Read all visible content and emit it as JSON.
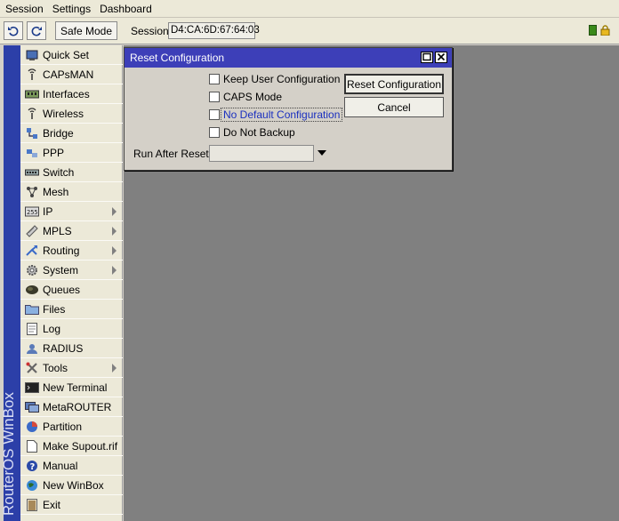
{
  "menubar": {
    "items": [
      "Session",
      "Settings",
      "Dashboard"
    ]
  },
  "toolbar": {
    "undo_icon": "undo-icon",
    "redo_icon": "redo-icon",
    "safe_mode_label": "Safe Mode",
    "session_label": "Session:",
    "session_value": "D4:CA:6D:67:64:03",
    "status_icons": [
      "connection-status-icon",
      "lock-icon"
    ]
  },
  "sidebar": {
    "brand": "RouterOS WinBox",
    "items": [
      {
        "label": "Quick Set",
        "icon": "quick-set-icon",
        "submenu": false
      },
      {
        "label": "CAPsMAN",
        "icon": "capsman-icon",
        "submenu": false
      },
      {
        "label": "Interfaces",
        "icon": "interfaces-icon",
        "submenu": false
      },
      {
        "label": "Wireless",
        "icon": "wireless-icon",
        "submenu": false
      },
      {
        "label": "Bridge",
        "icon": "bridge-icon",
        "submenu": false
      },
      {
        "label": "PPP",
        "icon": "ppp-icon",
        "submenu": false
      },
      {
        "label": "Switch",
        "icon": "switch-icon",
        "submenu": false
      },
      {
        "label": "Mesh",
        "icon": "mesh-icon",
        "submenu": false
      },
      {
        "label": "IP",
        "icon": "ip-icon",
        "submenu": true
      },
      {
        "label": "MPLS",
        "icon": "mpls-icon",
        "submenu": true
      },
      {
        "label": "Routing",
        "icon": "routing-icon",
        "submenu": true
      },
      {
        "label": "System",
        "icon": "system-gear-icon",
        "submenu": true
      },
      {
        "label": "Queues",
        "icon": "queues-icon",
        "submenu": false
      },
      {
        "label": "Files",
        "icon": "folder-icon",
        "submenu": false
      },
      {
        "label": "Log",
        "icon": "log-icon",
        "submenu": false
      },
      {
        "label": "RADIUS",
        "icon": "radius-icon",
        "submenu": false
      },
      {
        "label": "Tools",
        "icon": "tools-icon",
        "submenu": true
      },
      {
        "label": "New Terminal",
        "icon": "terminal-icon",
        "submenu": false
      },
      {
        "label": "MetaROUTER",
        "icon": "metarouter-icon",
        "submenu": false
      },
      {
        "label": "Partition",
        "icon": "partition-icon",
        "submenu": false
      },
      {
        "label": "Make Supout.rif",
        "icon": "supout-icon",
        "submenu": false
      },
      {
        "label": "Manual",
        "icon": "manual-help-icon",
        "submenu": false
      },
      {
        "label": "New WinBox",
        "icon": "winbox-globe-icon",
        "submenu": false
      },
      {
        "label": "Exit",
        "icon": "exit-icon",
        "submenu": false
      }
    ]
  },
  "dialog": {
    "title": "Reset Configuration",
    "options": [
      {
        "label": "Keep User Configuration",
        "checked": false,
        "focused": false
      },
      {
        "label": "CAPS Mode",
        "checked": false,
        "focused": false
      },
      {
        "label": "No Default Configuration",
        "checked": false,
        "focused": true
      },
      {
        "label": "Do Not Backup",
        "checked": false,
        "focused": false
      }
    ],
    "reset_button": "Reset Configuration",
    "cancel_button": "Cancel",
    "run_after_reset_label": "Run After Reset:",
    "run_after_reset_value": ""
  }
}
